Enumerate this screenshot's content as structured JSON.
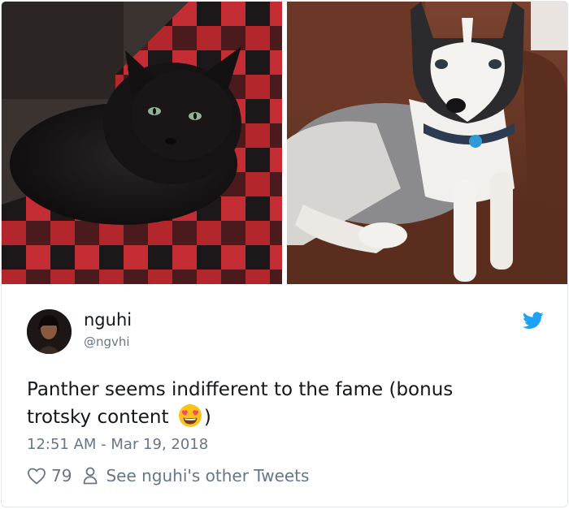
{
  "tweet": {
    "author_name": "nguhi",
    "author_handle": "@ngvhi",
    "text_before_emoji": "Panther seems indifferent to the fame (bonus trotsky content ",
    "text_after_emoji": ")",
    "emoji": "heart-eyes-emoji",
    "timestamp": "12:51 AM - Mar 19, 2018",
    "like_count": "79",
    "other_tweets_label": "See nguhi's other Tweets"
  },
  "media": {
    "left_photo": "black-cat-on-red-plaid-blanket",
    "right_photo": "husky-on-leather-couch"
  },
  "colors": {
    "twitter_blue": "#1da1f2",
    "secondary_text": "#657786",
    "primary_text": "#14171a",
    "border": "#e1e8ed"
  },
  "icons": {
    "brand": "twitter-bird-icon",
    "like": "heart-icon",
    "profile": "person-icon"
  }
}
